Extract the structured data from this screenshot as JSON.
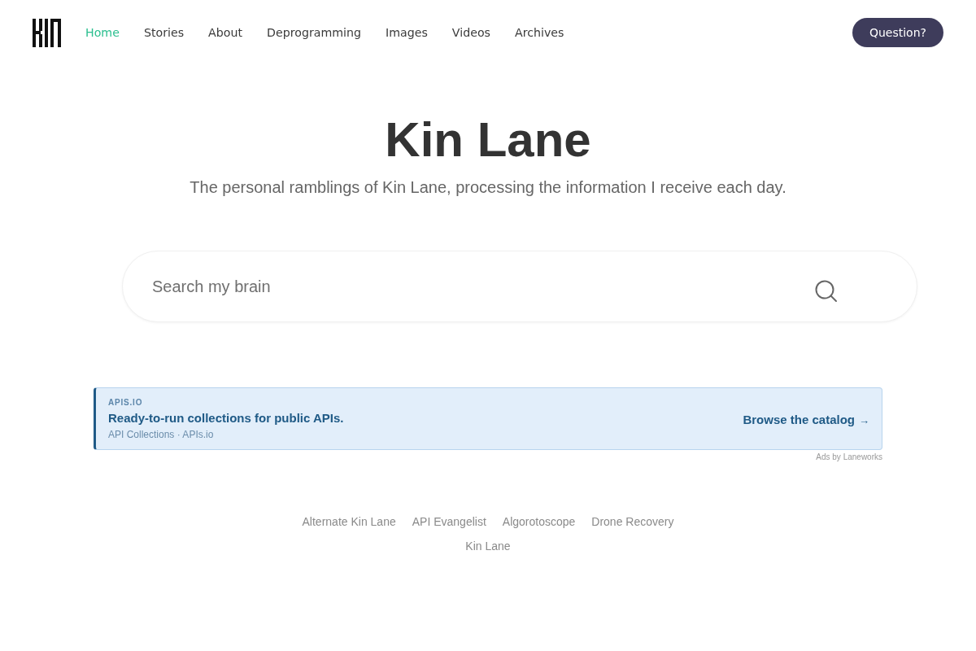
{
  "nav": {
    "items": [
      {
        "label": "Home",
        "selected": true
      },
      {
        "label": "Stories",
        "selected": false
      },
      {
        "label": "About",
        "selected": false
      },
      {
        "label": "Deprogramming",
        "selected": false
      },
      {
        "label": "Images",
        "selected": false
      },
      {
        "label": "Videos",
        "selected": false
      },
      {
        "label": "Archives",
        "selected": false
      }
    ],
    "button": "Question?"
  },
  "hero": {
    "title": "Kin Lane",
    "subtitle": "The personal ramblings of Kin Lane, processing the information I receive each day."
  },
  "search": {
    "placeholder": "Search my brain"
  },
  "ad": {
    "label": "APIS.IO",
    "headline": "Ready-to-run collections for public APIs.",
    "source": "API Collections · APIs.io",
    "cta": "Browse the catalog",
    "arrow": "→",
    "credit": "Ads by Laneworks"
  },
  "footer": {
    "links": [
      "Alternate Kin Lane",
      "API Evangelist",
      "Algorotoscope",
      "Drone Recovery"
    ],
    "credit": "Kin Lane"
  }
}
